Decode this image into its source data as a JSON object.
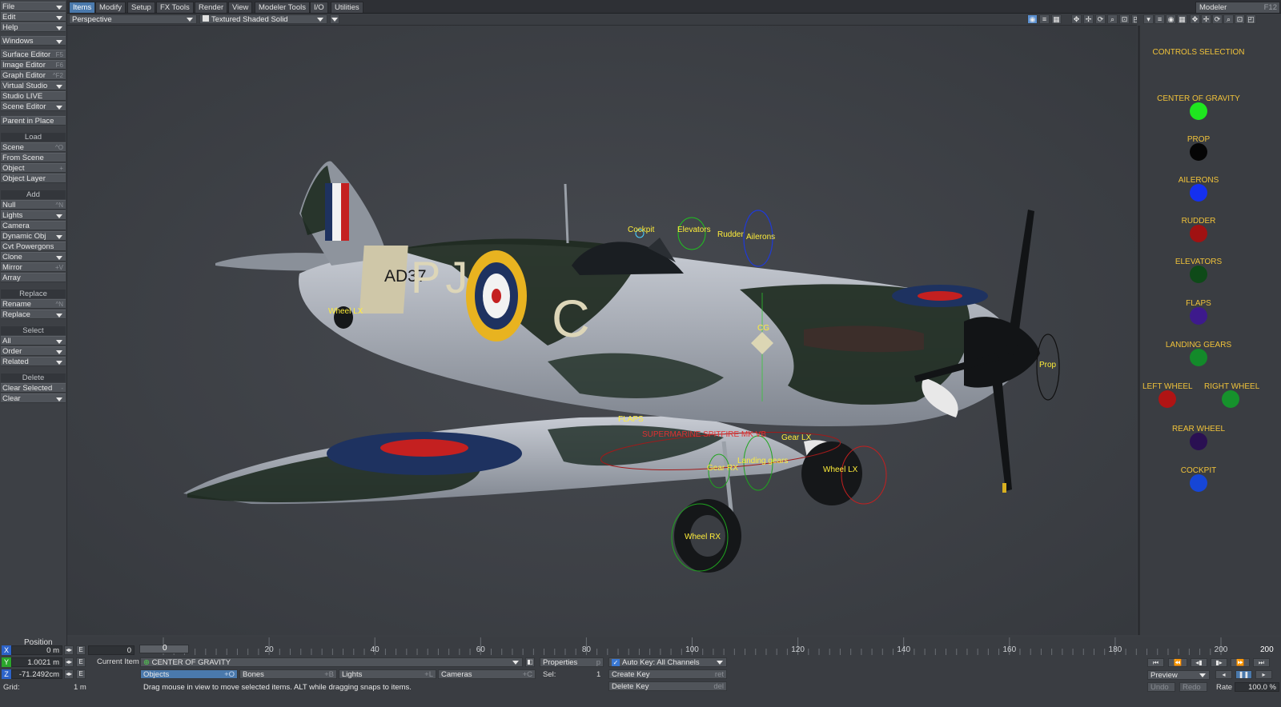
{
  "menubar": {
    "tabs": [
      "Items",
      "Modify",
      "Setup",
      "FX Tools",
      "Render",
      "View",
      "Modeler Tools",
      "I/O",
      "Utilities"
    ],
    "active_tab": "Items",
    "modeler_label": "Modeler",
    "modeler_shortcut": "F12"
  },
  "left_panel": {
    "file": "File",
    "edit": "Edit",
    "help": "Help",
    "windows": "Windows",
    "editors": [
      {
        "label": "Surface Editor",
        "shortcut": "F5"
      },
      {
        "label": "Image Editor",
        "shortcut": "F6"
      },
      {
        "label": "Graph Editor",
        "shortcut": "^F2"
      },
      {
        "label": "Virtual Studio",
        "shortcut": ""
      },
      {
        "label": "Studio LIVE",
        "shortcut": ""
      },
      {
        "label": "Scene Editor",
        "shortcut": ""
      }
    ],
    "parent_in_place": "Parent in Place",
    "load_header": "Load",
    "load_items": [
      {
        "label": "Scene",
        "shortcut": "^O"
      },
      {
        "label": "From Scene",
        "shortcut": ""
      },
      {
        "label": "Object",
        "shortcut": "+"
      },
      {
        "label": "Object Layer",
        "shortcut": ""
      }
    ],
    "add_header": "Add",
    "add_items": [
      {
        "label": "Null",
        "shortcut": "^N"
      },
      {
        "label": "Lights",
        "shortcut": ""
      },
      {
        "label": "Camera",
        "shortcut": ""
      },
      {
        "label": "Dynamic Obj",
        "shortcut": ""
      },
      {
        "label": "Cvt Powergons",
        "shortcut": ""
      },
      {
        "label": "Clone",
        "shortcut": ""
      },
      {
        "label": "Mirror",
        "shortcut": "+V"
      },
      {
        "label": "Array",
        "shortcut": ""
      }
    ],
    "replace_header": "Replace",
    "replace_items": [
      {
        "label": "Rename",
        "shortcut": "^N"
      },
      {
        "label": "Replace",
        "shortcut": ""
      }
    ],
    "select_header": "Select",
    "select_items": [
      "All",
      "Order",
      "Related"
    ],
    "delete_header": "Delete",
    "delete_items": [
      {
        "label": "Clear Selected",
        "shortcut": "-"
      },
      {
        "label": "Clear",
        "shortcut": ""
      }
    ]
  },
  "viewport": {
    "view_mode": "Perspective",
    "shading": "Textured Shaded Solid"
  },
  "scene_labels": {
    "cockpit": "Cockpit",
    "elevators": "Elevators",
    "rudder": "Rudder",
    "ailerons": "Ailerons",
    "wheel_lx_tail": "Wheel LX",
    "cg": "CG",
    "prop": "Prop",
    "flaps": "FLAPS",
    "title": "SUPERMARINE SPITFIRE MK VB",
    "gear_lx": "Gear LX",
    "landing_gears": "Landing gears",
    "gear_rx": "Gear RX",
    "wheel_lx": "Wheel LX",
    "wheel_rx": "Wheel RX",
    "fuselage_code": "AD37",
    "letters_left": "PJ",
    "letter_right": "C"
  },
  "controls": {
    "title": "CONTROLS SELECTION",
    "items": [
      {
        "label": "CENTER OF GRAVITY",
        "color": "#1fe61f"
      },
      {
        "label": "PROP",
        "color": "#050505"
      },
      {
        "label": "AILERONS",
        "color": "#1430f0"
      },
      {
        "label": "RUDDER",
        "color": "#a01212"
      },
      {
        "label": "ELEVATORS",
        "color": "#0e4a18"
      },
      {
        "label": "FLAPS",
        "color": "#3d1a8c"
      },
      {
        "label": "LANDING GEARS",
        "color": "#138a2a"
      },
      {
        "label": "LEFT WHEEL",
        "color": "#b01414"
      },
      {
        "label": "RIGHT WHEEL",
        "color": "#16922c"
      },
      {
        "label": "REAR WHEEL",
        "color": "#2a1052"
      },
      {
        "label": "COCKPIT",
        "color": "#1646d6"
      }
    ]
  },
  "timeline": {
    "ticks": [
      "0",
      "20",
      "40",
      "60",
      "80",
      "100",
      "120",
      "140",
      "160",
      "180",
      "200"
    ],
    "current_frame": "0",
    "end_frame": "200"
  },
  "bottom": {
    "position_label": "Position",
    "x_label": "X",
    "y_label": "Y",
    "z_label": "Z",
    "x_value": "0 m",
    "y_value": "1.0021 m",
    "z_value": "-71.2492cm",
    "frame_value": "0",
    "grid_label": "Grid:",
    "grid_value": "1 m",
    "current_item_label": "Current Item",
    "current_item": "CENTER OF GRAVITY",
    "objects": "Objects",
    "objects_sc": "+O",
    "bones": "Bones",
    "bones_sc": "+B",
    "lights": "Lights",
    "lights_sc": "+L",
    "cameras": "Cameras",
    "cameras_sc": "+C",
    "properties": "Properties",
    "properties_sc": "p",
    "sel_label": "Sel:",
    "sel_value": "1",
    "auto_key": "Auto Key: All Channels",
    "create_key": "Create Key",
    "create_key_sc": "ret",
    "delete_key": "Delete Key",
    "delete_key_sc": "del",
    "status": "Drag mouse in view to move selected items. ALT while dragging snaps to items.",
    "preview": "Preview",
    "undo": "Undo",
    "redo": "Redo",
    "rate_label": "Rate",
    "rate_value": "100.0 %",
    "e_label": "E"
  }
}
